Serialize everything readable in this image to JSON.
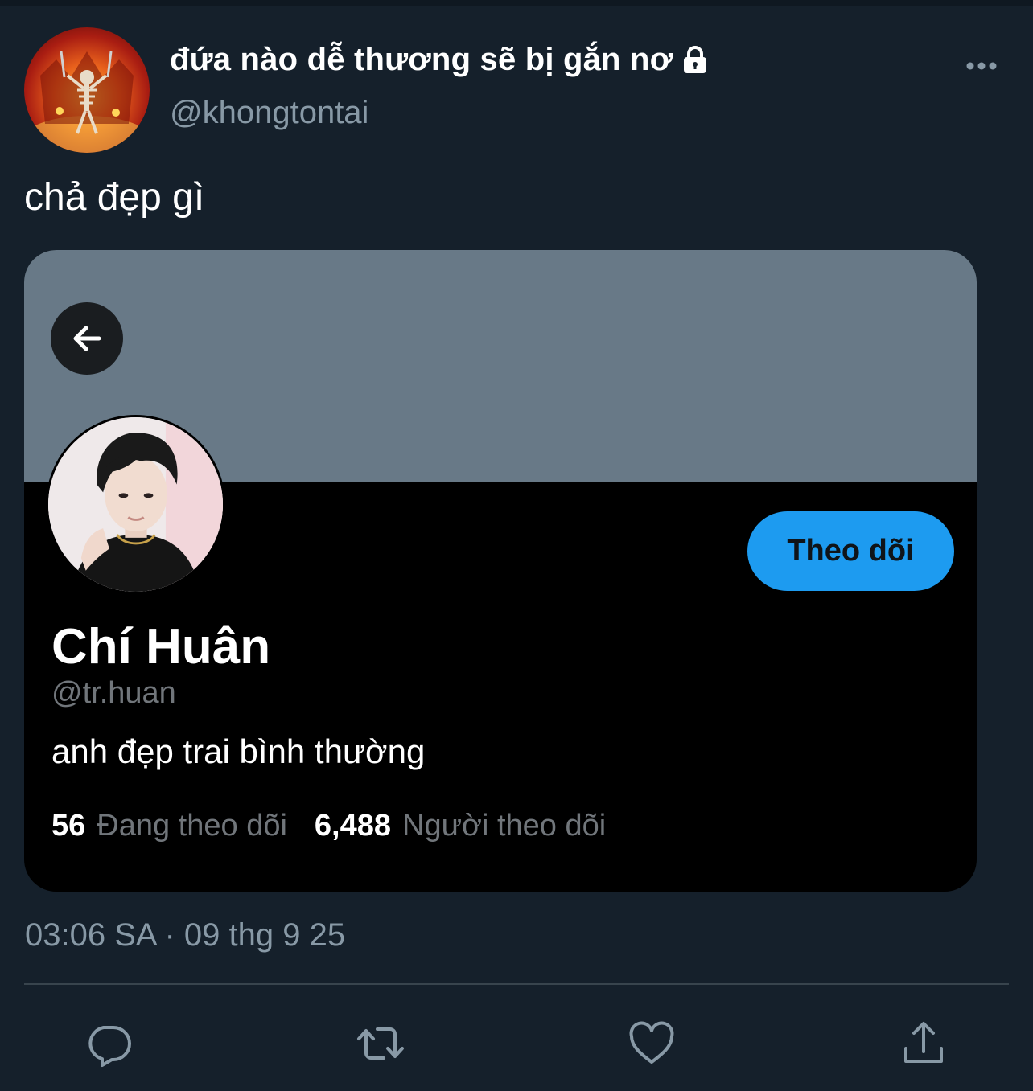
{
  "author": {
    "display_name": "đứa nào dễ thương sẽ bị gắn nơ",
    "handle": "@khongtontai",
    "verified_icon": "lock-icon"
  },
  "tweet": {
    "text": "chả đẹp gì",
    "timestamp": "03:06 SA · 09 thg 9 25"
  },
  "embedded_profile": {
    "banner_color": "#687987",
    "name": "Chí Huân",
    "handle": "@tr.huan",
    "bio": "anh đẹp trai bình thường",
    "follow_label": "Theo dõi",
    "following_count": "56",
    "following_label": "Đang theo dõi",
    "followers_count": "6,488",
    "followers_label": "Người theo dõi"
  },
  "actions": [
    "reply-icon",
    "retweet-icon",
    "like-icon",
    "share-icon"
  ],
  "colors": {
    "background": "#15202b",
    "accent": "#1d9bf0",
    "secondary_text": "#8899a6"
  }
}
